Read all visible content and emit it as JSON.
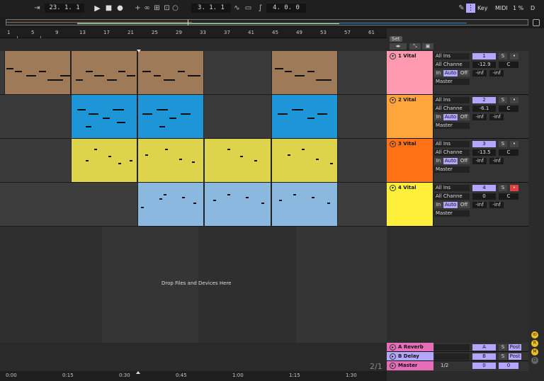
{
  "transport": {
    "bpm_pos": "23. 1. 1",
    "loop_start": "3. 1. 1",
    "loop_len": "4. 0. 0",
    "key_label": "Key",
    "midi_label": "MIDI",
    "cpu_label": "1 %",
    "d_label": "D"
  },
  "ruler": {
    "bars": [
      "1",
      "5",
      "9",
      "13",
      "17",
      "21",
      "25",
      "29",
      "33",
      "37",
      "41",
      "45",
      "49",
      "53",
      "57",
      "61"
    ]
  },
  "set_label": "Set",
  "drop_text": "Drop Files and Devices Here",
  "tracks": [
    {
      "name": "1 Vital",
      "color": "#ff9ab0",
      "input": "All Ins",
      "channel": "All Channe",
      "mon_in": "In",
      "mon_auto": "Auto",
      "mon_off": "Off",
      "output": "Master",
      "num": "1",
      "solo": "S",
      "volume": "-12.9",
      "pan": "C",
      "send_a": "-inf",
      "send_b": "-inf"
    },
    {
      "name": "2 Vital",
      "color": "#ffa53c",
      "input": "All Ins",
      "channel": "All Channe",
      "mon_in": "In",
      "mon_auto": "Auto",
      "mon_off": "Off",
      "output": "Master",
      "num": "2",
      "solo": "S",
      "volume": "-6.1",
      "pan": "C",
      "send_a": "-inf",
      "send_b": "-inf"
    },
    {
      "name": "3 Vital",
      "color": "#ff7316",
      "input": "All Ins",
      "channel": "All Channe",
      "mon_in": "In",
      "mon_auto": "Auto",
      "mon_off": "Off",
      "output": "Master",
      "num": "3",
      "solo": "S",
      "volume": "-13.5",
      "pan": "C",
      "send_a": "-inf",
      "send_b": "-inf"
    },
    {
      "name": "4 Vital",
      "color": "#ffee3a",
      "input": "All Ins",
      "channel": "All Channe",
      "mon_in": "In",
      "mon_auto": "Auto",
      "mon_off": "Off",
      "output": "Master",
      "num": "4",
      "solo": "S",
      "volume": "0",
      "pan": "C",
      "send_a": "-inf",
      "send_b": "-inf"
    }
  ],
  "returns": [
    {
      "name": "A Reverb",
      "letter": "A",
      "solo": "S",
      "post": "Post",
      "color": "#e56eb9"
    },
    {
      "name": "B Delay",
      "letter": "B",
      "solo": "S",
      "post": "Post",
      "color": "#b3a6ff"
    }
  ],
  "master": {
    "name": "Master",
    "ratio": "1/2",
    "vol": "0",
    "pan": "0",
    "color": "#e56eb9"
  },
  "time_signature": "2/1",
  "timeline": [
    "0:00",
    "0:15",
    "0:30",
    "0:45",
    "1:00",
    "1:15",
    "1:30"
  ],
  "right_buttons": [
    "IO",
    "R",
    "M",
    "D"
  ]
}
